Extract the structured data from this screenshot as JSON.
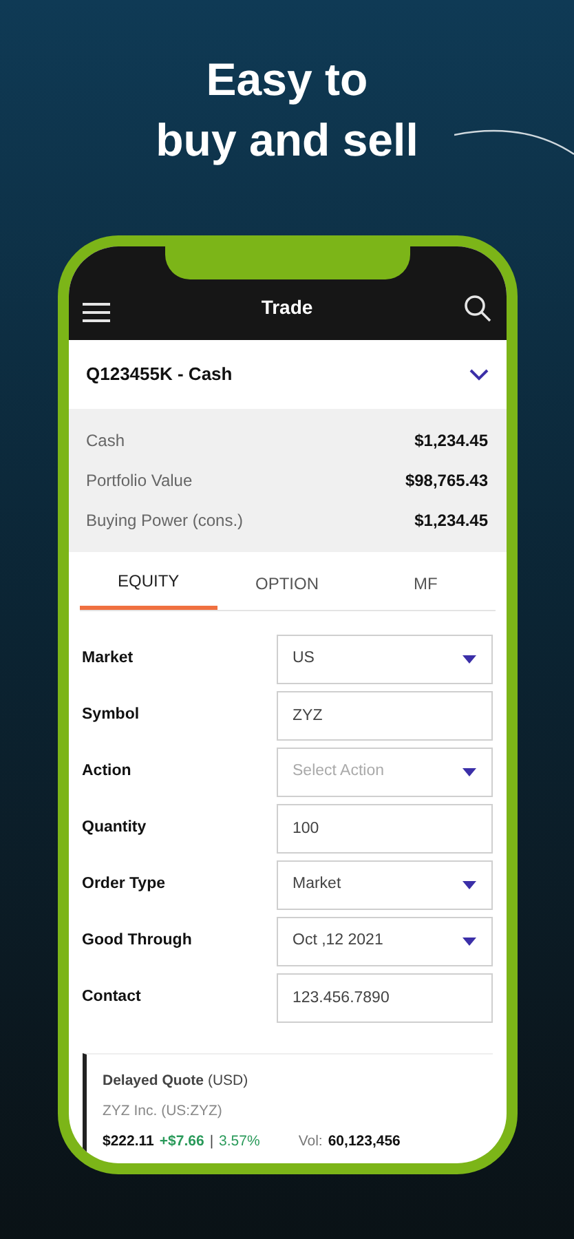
{
  "headline": [
    "Easy to",
    "buy and sell"
  ],
  "header": {
    "title": "Trade"
  },
  "account": {
    "label": "Q123455K - Cash"
  },
  "summary": [
    {
      "label": "Cash",
      "value": "$1,234.45"
    },
    {
      "label": "Portfolio Value",
      "value": "$98,765.43"
    },
    {
      "label": "Buying Power (cons.)",
      "value": "$1,234.45"
    }
  ],
  "tabs": [
    {
      "label": "EQUITY",
      "selected": true
    },
    {
      "label": "OPTION",
      "selected": false
    },
    {
      "label": "MF",
      "selected": false
    }
  ],
  "fields": [
    {
      "label": "Market",
      "kind": "select",
      "value": "US"
    },
    {
      "label": "Symbol",
      "kind": "text",
      "value": "ZYZ"
    },
    {
      "label": "Action",
      "kind": "select",
      "placeholder": "Select Action"
    },
    {
      "label": "Quantity",
      "kind": "text",
      "value": "100"
    },
    {
      "label": "Order Type",
      "kind": "select",
      "value": "Market"
    },
    {
      "label": "Good Through",
      "kind": "select",
      "value": "Oct ,12 2021"
    },
    {
      "label": "Contact",
      "kind": "text",
      "value": "123.456.7890"
    }
  ],
  "quote": {
    "title": "**Delayed Quote** (USD)",
    "name": "ZYZ Inc. (US:ZYZ)",
    "price": "$222.11",
    "change": "+$7.66",
    "separator": "|",
    "percent": "3.57%",
    "volume_label": "Vol:",
    "volume": "60,123,456"
  }
}
